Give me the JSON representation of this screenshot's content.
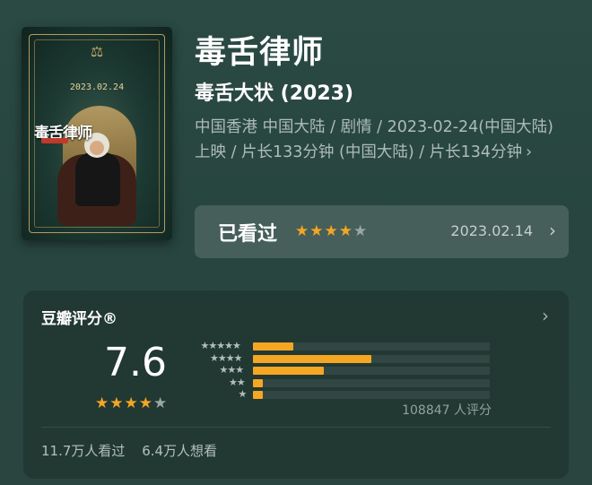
{
  "movie": {
    "title": "毒舌律师",
    "subtitle": "毒舌大状 (2023)",
    "info": "中国香港 中国大陆 / 剧情 / 2023-02-24(中国大陆) 上映 / 片长133分钟 (中国大陆) / 片长134分钟",
    "info_chevron": "›",
    "poster": {
      "title_text": "毒舌律师",
      "date_text": "2023.02.24",
      "emblem": "⚖"
    }
  },
  "watched": {
    "label": "已看过",
    "stars": 4,
    "max_stars": 5,
    "date": "2023.02.14",
    "chevron": "›"
  },
  "rating": {
    "heading": "豆瓣评分®",
    "heading_chevron": "›",
    "score": "7.6",
    "stars": 4,
    "max_stars": 5,
    "distribution": [
      {
        "stars": 5,
        "fraction": 0.17
      },
      {
        "stars": 4,
        "fraction": 0.5
      },
      {
        "stars": 3,
        "fraction": 0.3
      },
      {
        "stars": 2,
        "fraction": 0.04
      },
      {
        "stars": 1,
        "fraction": 0.04
      }
    ],
    "count_text": "108847 人评分",
    "watched_text": "11.7万人看过",
    "want_text": "6.4万人想看"
  },
  "colors": {
    "star_active": "#f5a623",
    "star_inactive": "#9aa8a3",
    "background": "#2b4a44"
  },
  "icons": {
    "star": "★",
    "chevron": "chevron-right-icon"
  }
}
